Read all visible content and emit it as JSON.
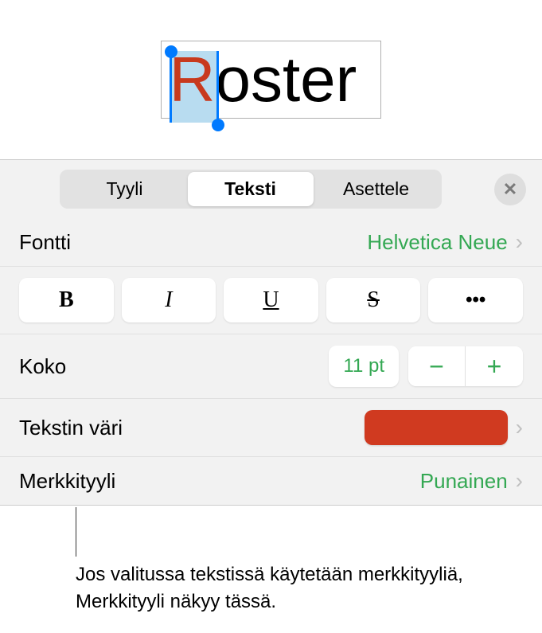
{
  "preview": {
    "first_char": "R",
    "rest": "oster"
  },
  "tabs": {
    "style": "Tyyli",
    "text": "Teksti",
    "layout": "Asettele"
  },
  "font_row": {
    "label": "Fontti",
    "value": "Helvetica Neue"
  },
  "style_buttons": {
    "bold": "B",
    "italic": "I",
    "underline": "U",
    "strike": "S",
    "more": "•••"
  },
  "size_row": {
    "label": "Koko",
    "value": "11 pt",
    "minus": "−",
    "plus": "+"
  },
  "color_row": {
    "label": "Tekstin väri",
    "color": "#d03a20"
  },
  "char_style_row": {
    "label": "Merkkityyli",
    "value": "Punainen"
  },
  "callout": {
    "text": "Jos valitussa tekstissä käytetään merkkityyliä, Merkkityyli näkyy tässä."
  }
}
